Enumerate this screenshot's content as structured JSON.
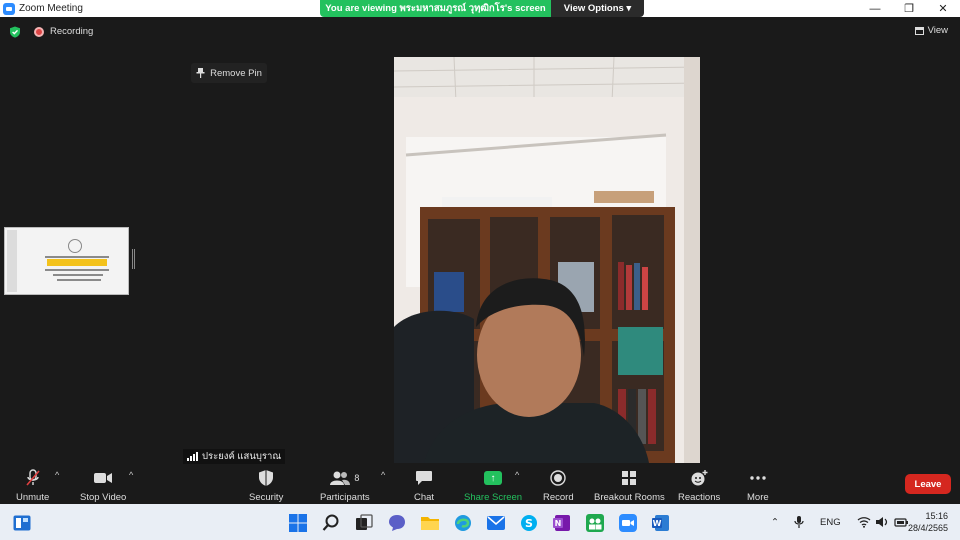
{
  "window": {
    "title": "Zoom Meeting",
    "minimize": "—",
    "restore": "❐",
    "close": "✕"
  },
  "share_banner": {
    "text": "You are viewing พระมหาสมภูรณ์ วุทฺฒิกโร's screen",
    "view_options": "View Options ▾"
  },
  "top": {
    "recording": "Recording",
    "view": "View",
    "remove_pin": "Remove Pin"
  },
  "participant": {
    "name": "ประยงค์ แสนบุราณ"
  },
  "toolbar": {
    "unmute": "Unmute",
    "stop_video": "Stop Video",
    "security": "Security",
    "participants": "Participants",
    "participants_count": "8",
    "chat": "Chat",
    "share_screen": "Share Screen",
    "record": "Record",
    "breakout_rooms": "Breakout Rooms",
    "reactions": "Reactions",
    "more": "More",
    "leave": "Leave",
    "caret": "^"
  },
  "taskbar": {
    "language": "ENG",
    "time": "15:16",
    "date": "28/4/2565"
  },
  "colors": {
    "share_green": "#23c15e",
    "leave_red": "#d5271f",
    "zoom_blue": "#2d8cff",
    "background": "#1a1a1a"
  }
}
